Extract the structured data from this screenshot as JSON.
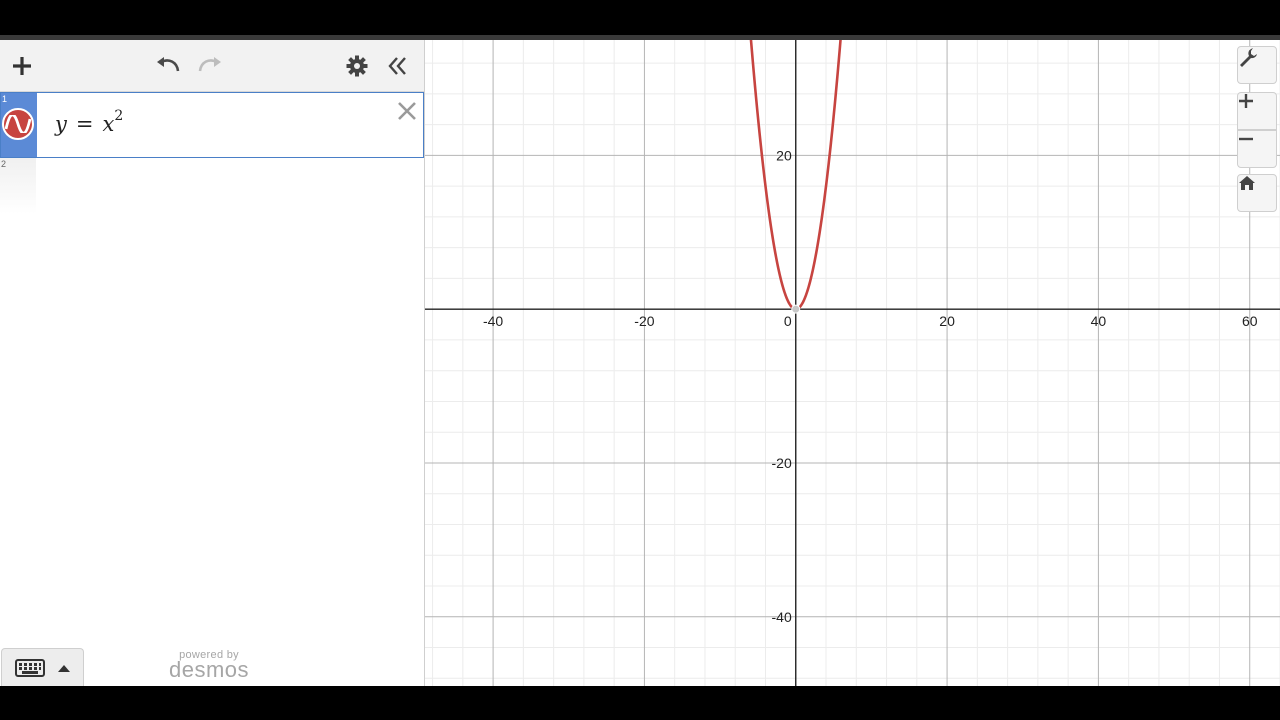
{
  "expressions": [
    {
      "index": "1",
      "lhs": "y",
      "op": "=",
      "base": "x",
      "exp": "2",
      "color": "#c74440"
    },
    {
      "index": "2"
    }
  ],
  "branding": {
    "powered": "powered by",
    "brand": "desmos"
  },
  "icons": {
    "add": "plus-icon",
    "undo": "undo-icon",
    "redo": "redo-icon",
    "settings": "gear-icon",
    "collapse": "double-chevron-left-icon",
    "delete": "close-icon",
    "keyboard": "keyboard-icon",
    "wrench": "wrench-icon",
    "zoom_in": "plus-icon",
    "zoom_out": "minus-icon",
    "home": "home-icon"
  },
  "chart_data": {
    "type": "line",
    "series": [
      {
        "expr": "y = x^2",
        "color": "#c74440"
      }
    ],
    "xlim": [
      -49,
      64
    ],
    "ylim": [
      -49,
      35
    ],
    "x_ticks": [
      "-40",
      "-20",
      "0",
      "20",
      "40",
      "60"
    ],
    "y_ticks": [
      "20",
      "-20",
      "-40"
    ],
    "grid": true
  }
}
